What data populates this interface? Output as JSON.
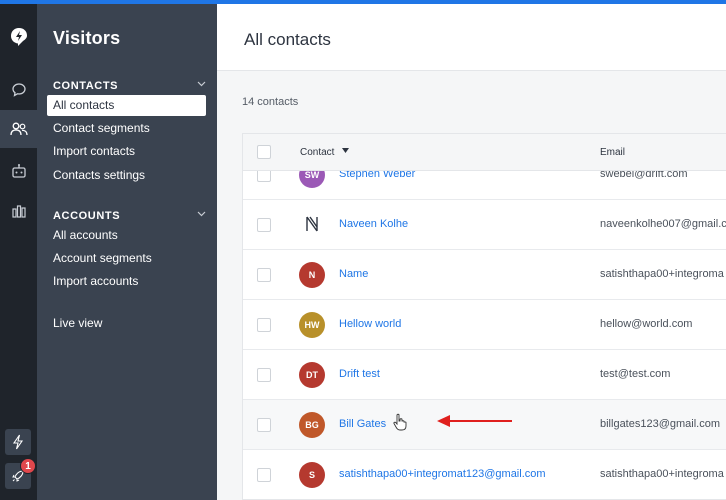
{
  "sidebar": {
    "title": "Visitors",
    "contacts_section": "CONTACTS",
    "contacts_items": [
      "All contacts",
      "Contact segments",
      "Import contacts",
      "Contacts settings"
    ],
    "accounts_section": "ACCOUNTS",
    "accounts_items": [
      "All accounts",
      "Account segments",
      "Import accounts"
    ],
    "live_view": "Live view"
  },
  "rail": {
    "icons": [
      "drift-logo-icon",
      "chat-icon",
      "contacts-icon",
      "bot-icon",
      "reports-icon",
      "lightning-icon",
      "rocket-icon"
    ],
    "notification_count": "1"
  },
  "main": {
    "title": "All contacts",
    "count_text": "14 contacts",
    "columns": {
      "contact": "Contact",
      "email": "Email"
    },
    "rows": [
      {
        "initials": "SW",
        "name": "Stephen Weber",
        "email": "swebel@drift.com",
        "color": "#9b59b6"
      },
      {
        "initials": "",
        "name": "Naveen Kolhe",
        "email": "naveenkolhe007@gmail.c",
        "color": "logo"
      },
      {
        "initials": "N",
        "name": "Name",
        "email": "satishthapa00+integroma",
        "color": "#b5392f"
      },
      {
        "initials": "HW",
        "name": "Hellow world",
        "email": "hellow@world.com",
        "color": "#b8902a"
      },
      {
        "initials": "DT",
        "name": "Drift test",
        "email": "test@test.com",
        "color": "#b5392f"
      },
      {
        "initials": "BG",
        "name": "Bill Gates",
        "email": "billgates123@gmail.com",
        "color": "#c0582a"
      },
      {
        "initials": "S",
        "name": "satishthapa00+integromat123@gmail.com",
        "email": "satishthapa00+integroma",
        "color": "#b5392f"
      }
    ]
  },
  "colors": {
    "accent": "#1f76e6",
    "rail": "#1f242b",
    "sidebar": "#3a4350",
    "annotation_arrow": "#e0201e"
  }
}
